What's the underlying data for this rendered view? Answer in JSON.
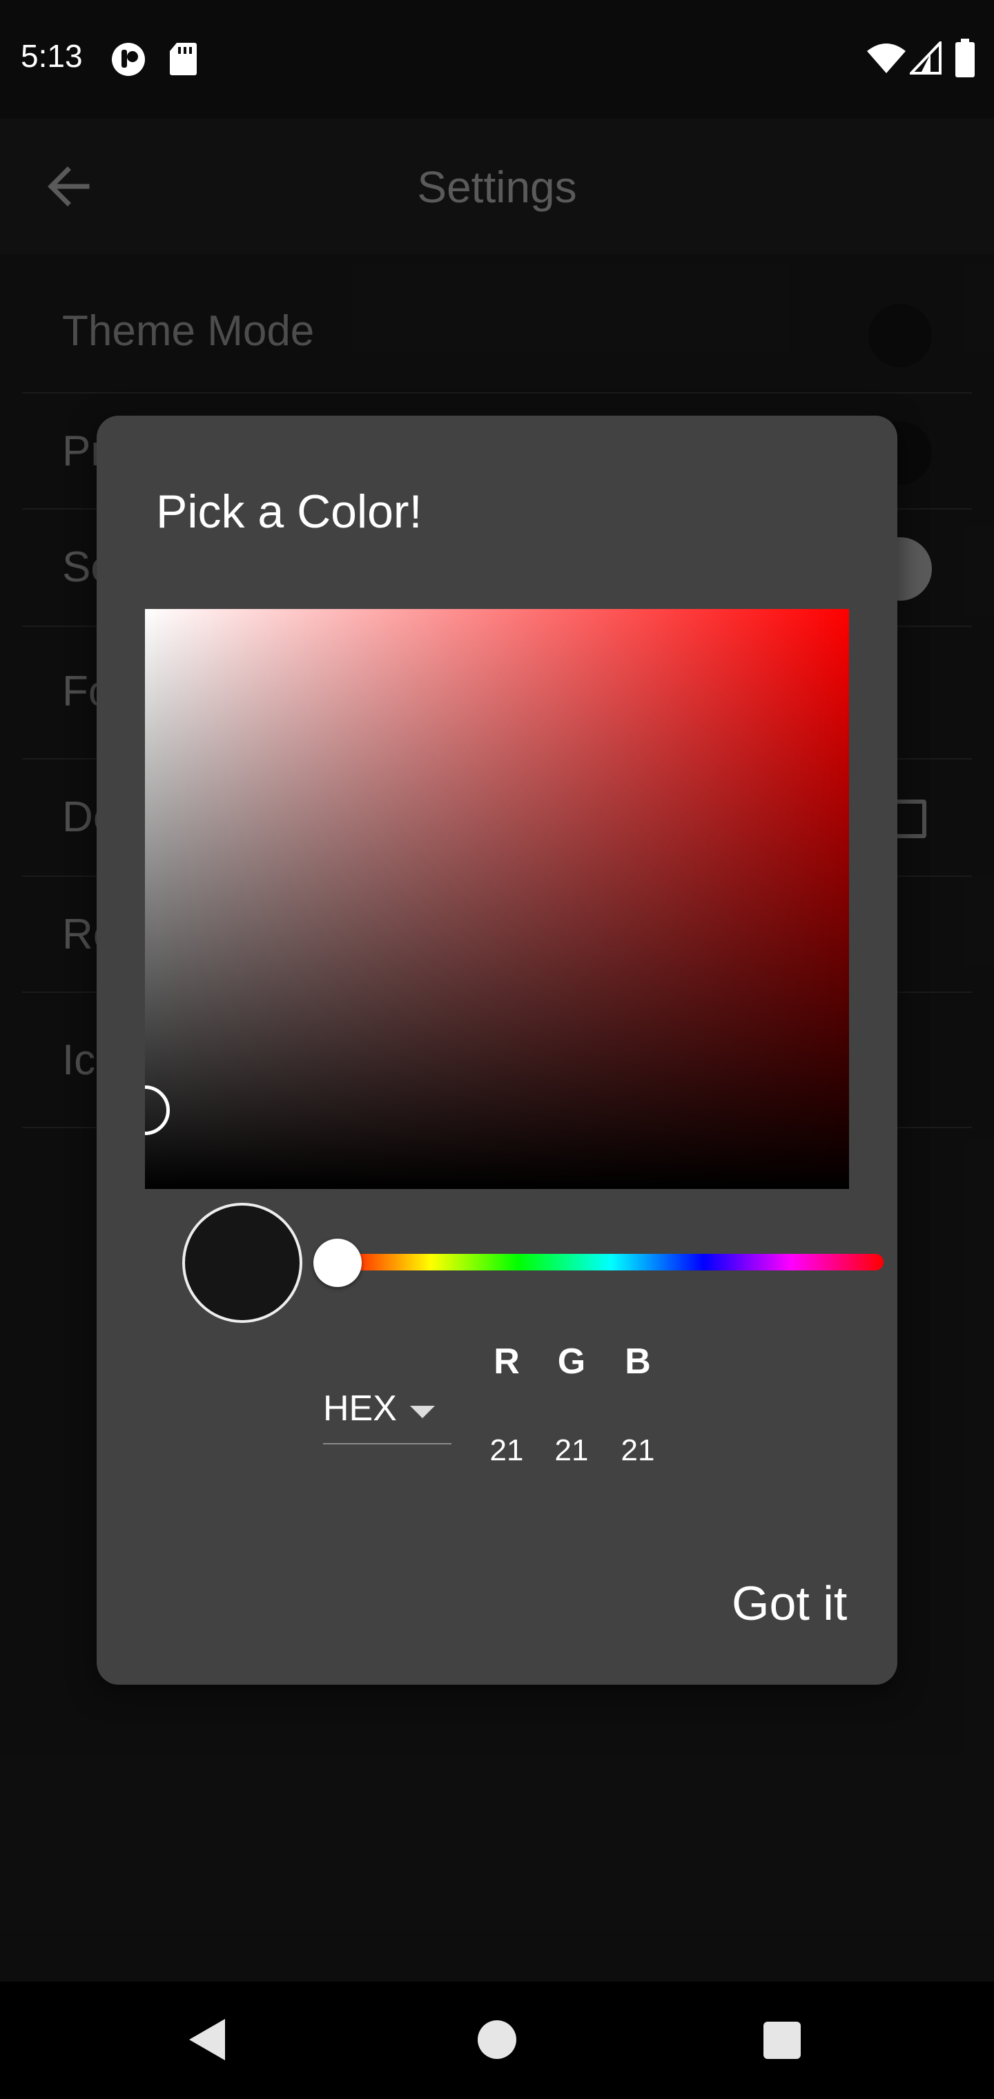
{
  "status_bar": {
    "time": "5:13"
  },
  "app_bar": {
    "title": "Settings"
  },
  "settings": [
    {
      "label": "Theme Mode"
    },
    {
      "label": "Pr"
    },
    {
      "label": "Se"
    },
    {
      "label": "Fo"
    },
    {
      "label": "De"
    },
    {
      "label": "Re"
    },
    {
      "label": "Ic"
    }
  ],
  "dialog": {
    "title": "Pick a Color!",
    "mode": "HEX",
    "rgb": {
      "labels": [
        "R",
        "G",
        "B"
      ],
      "values": [
        "21",
        "21",
        "21"
      ]
    },
    "selected_color": "#151515",
    "hue_color": "#ff0000",
    "confirm_label": "Got it"
  }
}
